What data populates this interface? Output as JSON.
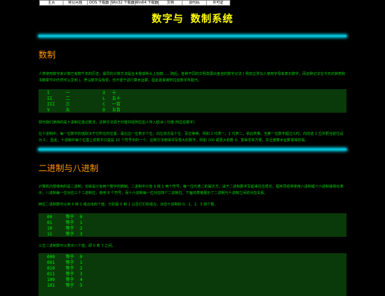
{
  "nav": [
    "主页",
    "常见问题",
    "DOS 下载器",
    "Win32 下载器",
    "Win64 下载器",
    "文档",
    "源代码",
    "许可证"
  ],
  "title": "数字与 数制系统",
  "sections": [
    {
      "heading": "数制",
      "p1": "人类使用数字来计数已有数千年的历史，最早的计数方法是在木棍或骨头上刻痕……随后，各种不同的文明发展出各自的数字记法 ( 例如古罗马人使用字母来表示数字，而这种记法在今天的钟表和书籍章节中仍然可以见到 )。罗马数字没有零，也不便于进行算术运算，因此逐渐被阿拉伯数字所取代。",
      "roman_table": [
        [
          "I",
          "一",
          "X",
          "十"
        ],
        [
          "II",
          "二",
          "L",
          "五十"
        ],
        [
          "III",
          "三",
          "C",
          "一百"
        ],
        [
          "V",
          "五",
          "D",
          "五百"
        ]
      ],
      "p2": "现代我们使用的是十进制位值记数法，这种方法源于印度并经阿拉伯人传入欧洲 ( 印度-阿拉伯数字)",
      "p3": "在十进制中，每一位数字的值取决于它所在的位置，最右边一位表示个位，向左依次是十位、百位等等。例如 1 代表一，2 代表二，依此类推。当某一位数字超过九时，向前进 1 位并把当前位设为 0 。因此，十进制中每个位置上的数字只能是 10 个符号中的一个。这种方法使得书写很大的数字，例如 100 或更大的数 0，变得非常方便，并且使算术运算变得容易。"
    },
    {
      "heading": "二进制与八进制",
      "p4": "计算机内部使用的是二进制，也就是只有两个数字的数制。二进制中只有 0 和 1 两个符号，每一位代表二的幂次方。由于二进制数字写起来往往很长，程序员经常使用八进制或十六进制来简化表示。八进制每一位对应三个二进制位，使用 8 个符号，而十六进制每一位对应四个二进制位。下面的表格展示了二进制与十进制之间的对应关系。",
      "p5": "两位二进制数可以用 0 和 1 组合出四个值，分别是 0 和 1 以及它们的组合，对应十进制的 0、1、2、3 四个数。",
      "bin2": [
        [
          "00",
          "等于",
          "0"
        ],
        [
          "01",
          "等于",
          "1"
        ],
        [
          "10",
          "等于",
          "2"
        ],
        [
          "11",
          "等于",
          "3"
        ]
      ],
      "p6": "三位二进制数可以表示八个值，即 0 到 7 之间。",
      "bin3": [
        [
          "000",
          "等于",
          "0"
        ],
        [
          "001",
          "等于",
          "1"
        ],
        [
          "010",
          "等于",
          "2"
        ],
        [
          "011",
          "等于",
          "3"
        ],
        [
          "100",
          "等于",
          "4"
        ],
        [
          "101",
          "等于",
          "5"
        ]
      ]
    }
  ]
}
